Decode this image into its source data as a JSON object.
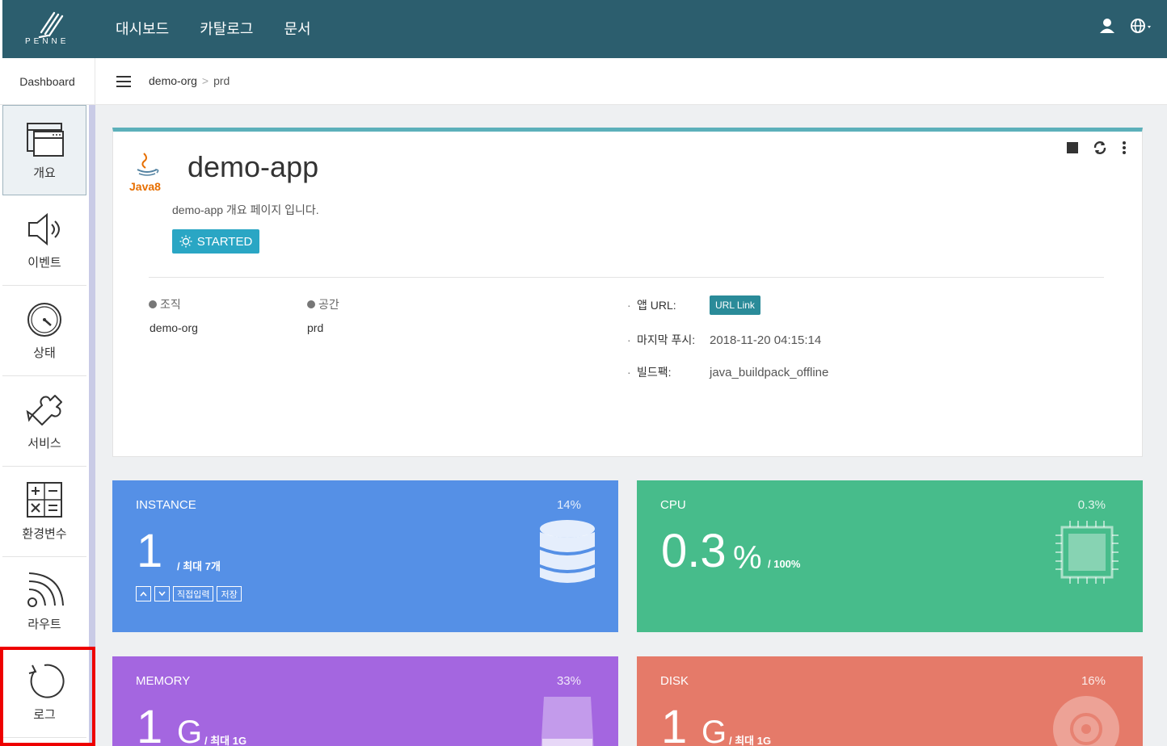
{
  "brand": {
    "logo_text": "PENNE"
  },
  "topnav": [
    "대시보드",
    "카탈로그",
    "문서"
  ],
  "crumbbar": {
    "left_label": "Dashboard",
    "org": "demo-org",
    "space": "prd",
    "separator": ">"
  },
  "sidebar": [
    {
      "label": "개요",
      "icon": "window-icon"
    },
    {
      "label": "이벤트",
      "icon": "speaker-icon"
    },
    {
      "label": "상태",
      "icon": "gauge-icon"
    },
    {
      "label": "서비스",
      "icon": "puzzle-icon"
    },
    {
      "label": "환경변수",
      "icon": "calculator-icon"
    },
    {
      "label": "라우트",
      "icon": "rss-icon"
    },
    {
      "label": "로그",
      "icon": "refresh-icon"
    }
  ],
  "app": {
    "runtime_logo": "Java8",
    "title": "demo-app",
    "description": "demo-app 개요 페이지 입니다.",
    "status": "STARTED",
    "org_label": "조직",
    "org_value": "demo-org",
    "space_label": "공간",
    "space_value": "prd",
    "url_label": "앱 URL:",
    "url_button": "URL Link",
    "push_label": "마지막 푸시:",
    "push_value": "2018-11-20 04:15:14",
    "buildpack_label": "빌드팩:",
    "buildpack_value": "java_buildpack_offline",
    "bullet": "·"
  },
  "tiles": {
    "instance": {
      "title": "INSTANCE",
      "pct": "14%",
      "big": "1",
      "sub": "/ 최대 7개",
      "btn_input": "직접입력",
      "btn_save": "저장",
      "color": "#5590e6"
    },
    "cpu": {
      "title": "CPU",
      "pct": "0.3%",
      "big": "0.3",
      "unit": "%",
      "sub": "/ 100%",
      "color": "#47bc8b"
    },
    "memory": {
      "title": "MEMORY",
      "pct": "33%",
      "big": "1",
      "unit": "G",
      "sub": "/ 최대 1G",
      "color": "#a466e0"
    },
    "disk": {
      "title": "DISK",
      "pct": "16%",
      "big": "1",
      "unit": "G",
      "sub": "/ 최대 1G",
      "color": "#e57a69"
    }
  }
}
